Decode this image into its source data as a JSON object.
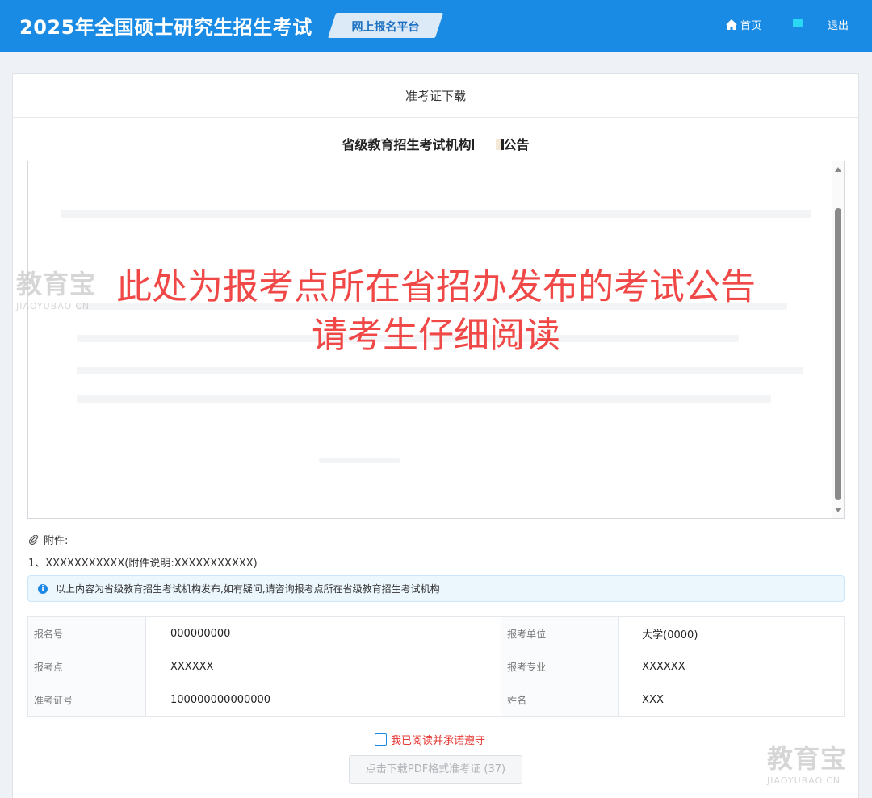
{
  "header": {
    "app_title": "2025年全国硕士研究生招生考试",
    "platform_tag": "网上报名平台",
    "nav_home": "首页",
    "nav_logout": "退出"
  },
  "panel": {
    "title": "准考证下载",
    "notice_title_prefix": "省级教育招生考试机构",
    "notice_title_suffix": "公告"
  },
  "overlay": {
    "line1": "此处为报考点所在省招办发布的考试公告",
    "line2": "请考生仔细阅读"
  },
  "watermark": {
    "cn": "教育宝",
    "en": "JIAOYUBAO.CN"
  },
  "attachments": {
    "label": "附件:",
    "items": [
      {
        "index": "1、",
        "name": "XXXXXXXXXXX",
        "desc": "(附件说明:XXXXXXXXXXX)"
      }
    ]
  },
  "alert": {
    "text": "以上内容为省级教育招生考试机构发布,如有疑问,请咨询报考点所在省级教育招生考试机构"
  },
  "info_table": {
    "rows": [
      {
        "label1": "报名号",
        "value1": "000000000",
        "label2": "报考单位",
        "value2": "大学(0000)"
      },
      {
        "label1": "报考点",
        "value1": "XXXXXX",
        "label2": "报考专业",
        "value2": "XXXXXX"
      },
      {
        "label1": "准考证号",
        "value1": "100000000000000",
        "label2": "姓名",
        "value2": "XXX"
      }
    ]
  },
  "agree_label": "我已阅读并承诺遵守",
  "download_button": "点击下载PDF格式准考证 (37)",
  "colors": {
    "topbar": "#1a8be4",
    "overlay_text": "#f04747",
    "agree_text": "#e53935"
  },
  "icons": {
    "home": "home-icon",
    "user": "user-icon",
    "attachment": "paperclip-icon",
    "info": "info-icon"
  }
}
